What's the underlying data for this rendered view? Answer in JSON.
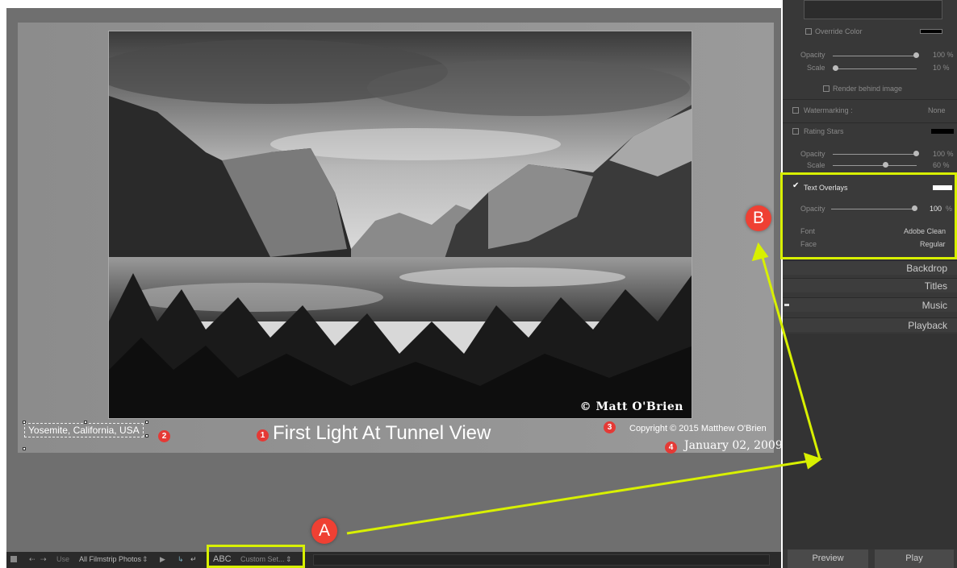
{
  "slide": {
    "photo_credit": "© Matt O'Brien",
    "overlays": {
      "location": "Yosemite, California, USA",
      "title": "First Light At Tunnel View",
      "copyright": "Copyright © 2015  Matthew O'Brien",
      "date": "January 02, 2009"
    },
    "badges": [
      "1",
      "2",
      "3",
      "4"
    ]
  },
  "toolbar": {
    "use_label": "Use",
    "use_value": "All Filmstrip Photos",
    "abc_label": "ABC",
    "custom_label": "Custom Set..."
  },
  "panel": {
    "override_color": "Override Color",
    "opacity_label": "Opacity",
    "opacity_value": "100 %",
    "scale_label": "Scale",
    "scale_value": "10 %",
    "render_behind": "Render behind image",
    "watermarking_label": "Watermarking :",
    "watermarking_value": "None",
    "rating_stars": "Rating Stars",
    "stars_scale_value": "60 %",
    "text_overlays": "Text Overlays",
    "text_opacity_value": "100",
    "percent": "%",
    "font_label": "Font",
    "font_value": "Adobe Clean",
    "face_label": "Face",
    "face_value": "Regular",
    "sections": [
      "Backdrop",
      "Titles",
      "Music",
      "Playback"
    ],
    "preview_button": "Preview",
    "play_button": "Play"
  },
  "annotations": {
    "callout_a": "A",
    "callout_b": "B",
    "highlight_color": "#d8f000",
    "badge_color": "#ef4033"
  }
}
